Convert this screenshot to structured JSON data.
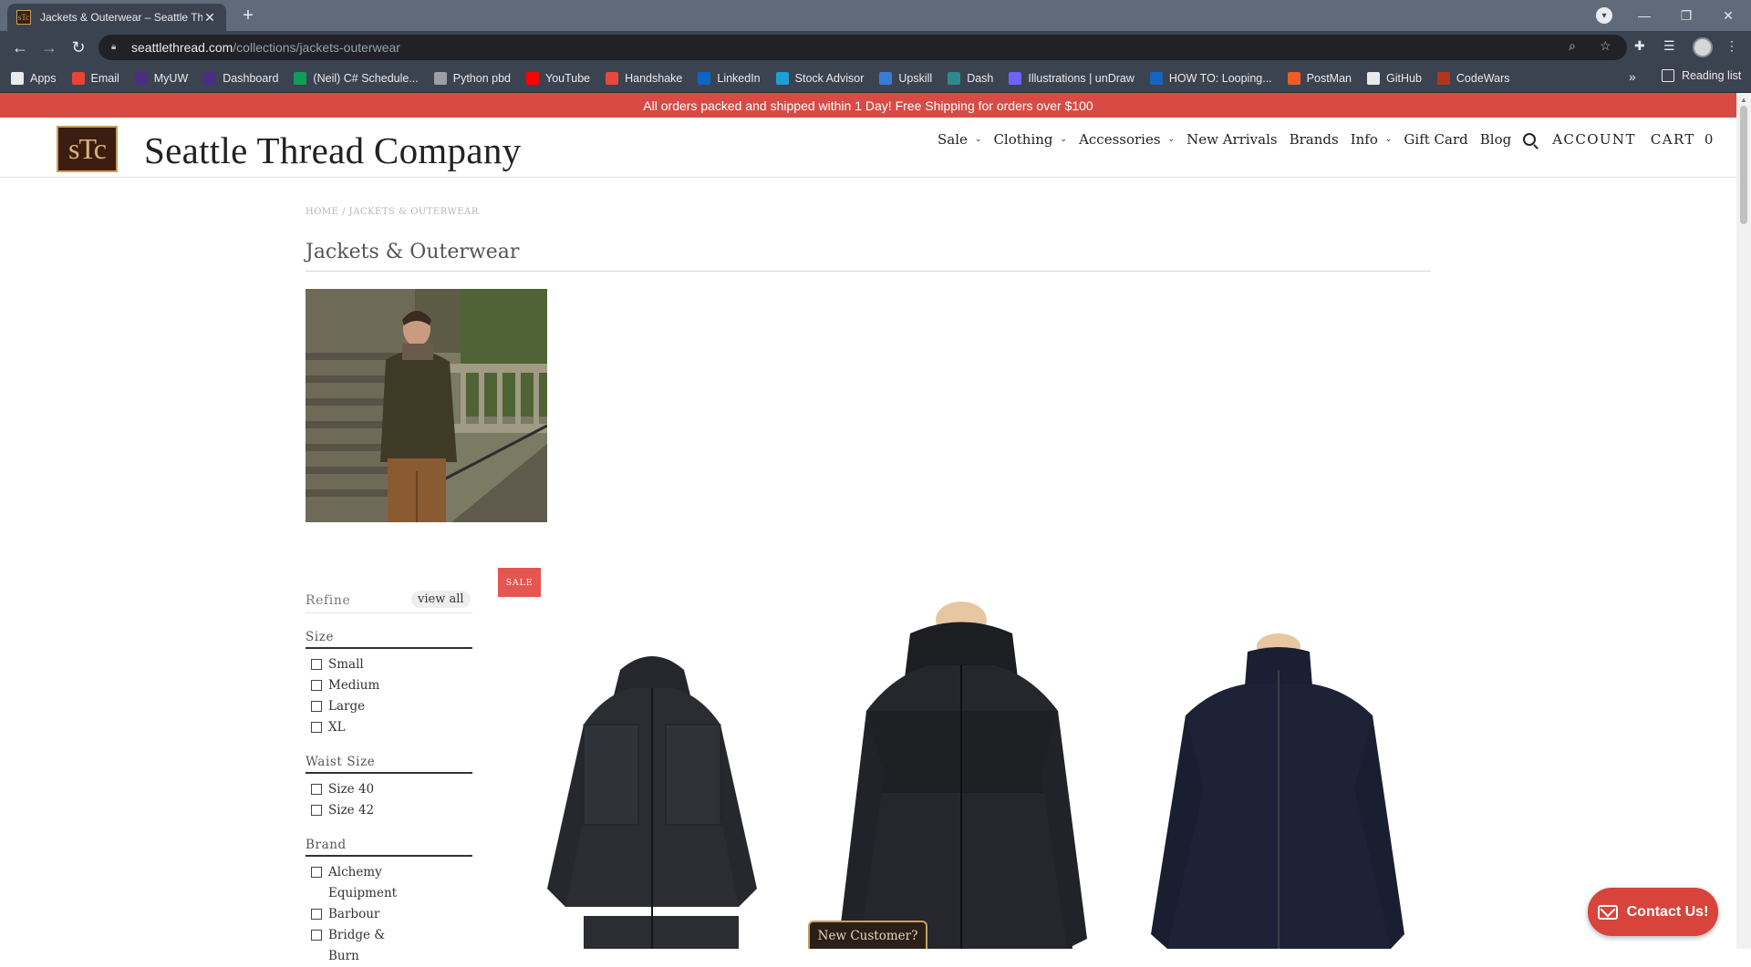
{
  "browser": {
    "tab_title": "Jackets & Outerwear – Seattle Th",
    "favicon_text": "sTc",
    "url_host": "seattlethread.com",
    "url_path": "/collections/jackets-outerwear",
    "bookmarks": [
      {
        "label": "Apps",
        "icon": "apps-grid-icon",
        "color": "#e8eaed"
      },
      {
        "label": "Email",
        "icon": "gmail-icon",
        "color": "#ea4335"
      },
      {
        "label": "MyUW",
        "icon": "uw-icon",
        "color": "#4b2e83"
      },
      {
        "label": "Dashboard",
        "icon": "uw-dashboard-icon",
        "color": "#4b2e83"
      },
      {
        "label": "(Neil) C# Schedule...",
        "icon": "sheets-icon",
        "color": "#0f9d58"
      },
      {
        "label": "Python pbd",
        "icon": "python-icon",
        "color": "#9aa0a6"
      },
      {
        "label": "YouTube",
        "icon": "youtube-icon",
        "color": "#ff0000"
      },
      {
        "label": "Handshake",
        "icon": "handshake-icon",
        "color": "#e8473d"
      },
      {
        "label": "LinkedIn",
        "icon": "linkedin-icon",
        "color": "#0a66c2"
      },
      {
        "label": "Stock Advisor",
        "icon": "stock-advisor-icon",
        "color": "#1a9fd6"
      },
      {
        "label": "Upskill",
        "icon": "upskill-icon",
        "color": "#3a7bd5"
      },
      {
        "label": "Dash",
        "icon": "dash-icon",
        "color": "#2e8a8a"
      },
      {
        "label": "Illustrations | unDraw",
        "icon": "undraw-icon",
        "color": "#6c63ff"
      },
      {
        "label": "HOW TO: Looping...",
        "icon": "page-icon",
        "color": "#1565c0"
      },
      {
        "label": "PostMan",
        "icon": "postman-icon",
        "color": "#ef5b25"
      },
      {
        "label": "GitHub",
        "icon": "github-icon",
        "color": "#e8eaed"
      },
      {
        "label": "CodeWars",
        "icon": "codewars-icon",
        "color": "#b1361e"
      }
    ],
    "reading_list": "Reading list"
  },
  "promo": {
    "text": "All orders packed and shipped within 1 Day! Free Shipping for orders over $100",
    "color": "#d84b44"
  },
  "header": {
    "logo_mark": "sTc",
    "logo_text": "Seattle Thread Company",
    "nav": [
      {
        "label": "Sale",
        "dropdown": true
      },
      {
        "label": "Clothing",
        "dropdown": true
      },
      {
        "label": "Accessories",
        "dropdown": true
      },
      {
        "label": "New Arrivals",
        "dropdown": false
      },
      {
        "label": "Brands",
        "dropdown": false
      },
      {
        "label": "Info",
        "dropdown": true
      },
      {
        "label": "Gift Card",
        "dropdown": false
      },
      {
        "label": "Blog",
        "dropdown": false
      }
    ],
    "account": "ACCOUNT",
    "cart": "CART",
    "cart_count": "0"
  },
  "breadcrumb": "HOME / JACKETS & OUTERWEAR",
  "page_title": "Jackets & Outerwear",
  "sale_badge": "SALE",
  "refine": {
    "title": "Refine",
    "view_all": "view all",
    "filters": [
      {
        "title": "Size",
        "options": [
          "Small",
          "Medium",
          "Large",
          "XL"
        ]
      },
      {
        "title": "Waist Size",
        "options": [
          "Size 40",
          "Size 42"
        ]
      },
      {
        "title": "Brand",
        "options": [
          "Alchemy Equipment",
          "Barbour",
          "Bridge & Burn"
        ]
      }
    ]
  },
  "widgets": {
    "new_customer": "New Customer?",
    "contact_us": "Contact Us!"
  }
}
